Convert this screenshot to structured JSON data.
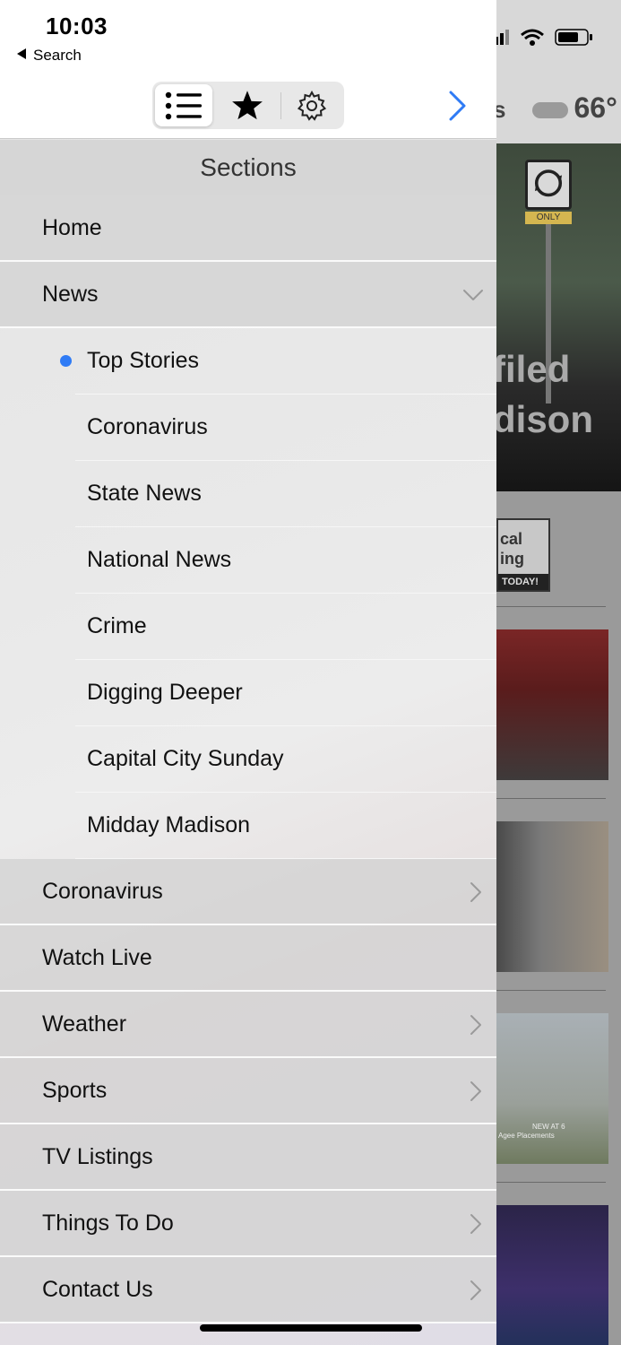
{
  "status": {
    "time": "10:03",
    "back_label": "Search"
  },
  "toolbar": {
    "segments": [
      {
        "icon": "list-icon",
        "selected": true
      },
      {
        "icon": "star-icon",
        "selected": false
      },
      {
        "icon": "gear-icon",
        "selected": false
      }
    ],
    "forward_icon": "chevron-right-icon",
    "accent_color": "#2f7bf5"
  },
  "panel": {
    "title": "Sections",
    "items": [
      {
        "label": "Home",
        "level": 0
      },
      {
        "label": "News",
        "level": 0,
        "expanded": true
      },
      {
        "label": "Top Stories",
        "level": 1,
        "selected": true
      },
      {
        "label": "Coronavirus",
        "level": 1
      },
      {
        "label": "State News",
        "level": 1
      },
      {
        "label": "National News",
        "level": 1
      },
      {
        "label": "Crime",
        "level": 1
      },
      {
        "label": "Digging Deeper",
        "level": 1
      },
      {
        "label": "Capital City Sunday",
        "level": 1
      },
      {
        "label": "Midday Madison",
        "level": 1
      },
      {
        "label": "Coronavirus",
        "level": 0,
        "has_children": true
      },
      {
        "label": "Watch Live",
        "level": 0
      },
      {
        "label": "Weather",
        "level": 0,
        "has_children": true
      },
      {
        "label": "Sports",
        "level": 0,
        "has_children": true
      },
      {
        "label": "TV Listings",
        "level": 0
      },
      {
        "label": "Things To Do",
        "level": 0,
        "has_children": true
      },
      {
        "label": "Contact Us",
        "level": 0,
        "has_children": true
      }
    ]
  },
  "background": {
    "temperature": "66°",
    "headline_line1": "filed",
    "headline_line2": "dison",
    "sign_text": "ONLY",
    "ad_text_line1": "cal",
    "ad_text_line2": "ing",
    "ad_band": "TODAY!",
    "thumb_caption": "NEW AT 6",
    "thumb_subcaption": "Agee Placements"
  }
}
